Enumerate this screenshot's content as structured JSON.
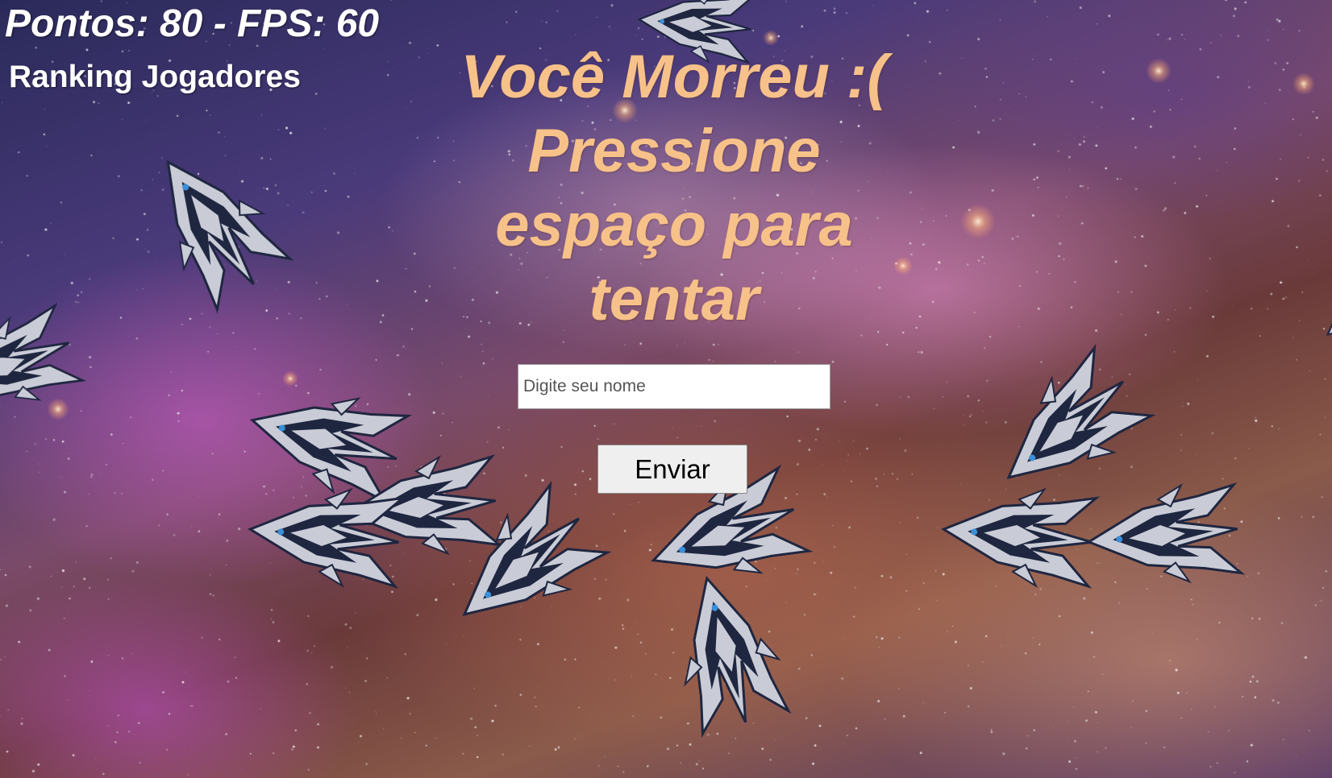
{
  "hud": {
    "score_label": "Pontos: 80 - FPS: 60",
    "points": 80,
    "fps": 60
  },
  "ranking": {
    "title": "Ranking Jogadores"
  },
  "game_over": {
    "message": "Você Morreu :( Pressione espaço para tentar"
  },
  "form": {
    "name_placeholder": "Digite seu nome",
    "name_value": "",
    "submit_label": "Enviar"
  },
  "colors": {
    "message": "#f7c18a",
    "hud_text": "#ffffff",
    "ship_hull": "#c9ccd6",
    "ship_dark": "#1f2640",
    "ship_accent": "#3a8fd8"
  },
  "sprites": {
    "enemy_icon": "spaceship-icon"
  }
}
